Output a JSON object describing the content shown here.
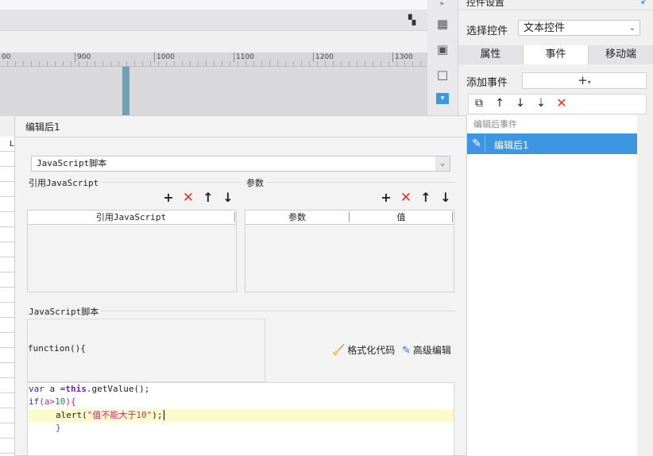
{
  "ruler": {
    "ticks": [
      "00",
      "900",
      "1000",
      "1100",
      "1200",
      "1300"
    ]
  },
  "right_panel": {
    "title": "控件设置",
    "select_label": "选择控件",
    "select_value": "文本控件",
    "tabs": [
      {
        "label": "属性",
        "active": false
      },
      {
        "label": "事件",
        "active": true
      },
      {
        "label": "移动端",
        "active": false
      }
    ],
    "add_event_label": "添加事件",
    "add_event_symbol": "+",
    "event_group_header": "编辑后事件",
    "event_item": "编辑后1"
  },
  "dialog": {
    "title": "编辑后1",
    "type_value": "JavaScript脚本",
    "ref_group_label": "引用JavaScript",
    "param_group_label": "参数",
    "ref_table": {
      "headers": [
        "引用JavaScript"
      ]
    },
    "param_table": {
      "headers": [
        "参数",
        "值"
      ]
    },
    "script_group_label": "JavaScript脚本",
    "function_label": "function(){",
    "format_button": "格式化代码",
    "advanced_button": "高级编辑",
    "code": {
      "line1": {
        "kw": "var",
        "rest": " a =",
        "this": "this",
        "call": ".getValue();"
      },
      "line2": {
        "kw": "if",
        "open": "(a>",
        "num": "10",
        "close": "){"
      },
      "line3": {
        "fn": "alert(",
        "str": "\"值不能大于10\"",
        "end": ");"
      },
      "line4": {
        "brace": "}"
      }
    }
  },
  "colors": {
    "accent": "#3d96e2",
    "delete_red": "#e0322a",
    "highlight_line": "#fdfbc9"
  }
}
